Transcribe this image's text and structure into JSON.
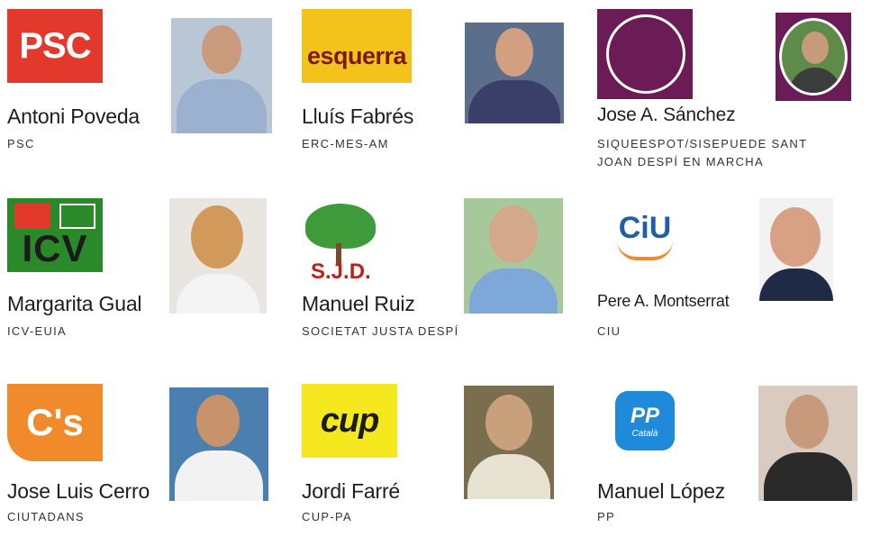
{
  "candidates": [
    {
      "name": "Antoni Poveda",
      "party": "PSC",
      "logo_text": "PSC",
      "logo": "psc-logo"
    },
    {
      "name": "Lluís Fabrés",
      "party": "ERC-MES-AM",
      "logo_text": "esquerra",
      "logo": "erc-logo"
    },
    {
      "name": "Jose A. Sánchez",
      "party": "SIQUEESPOT/SISEPUEDE SANT JOAN DESPÍ EN MARCHA",
      "logo_text": "",
      "logo": "sisepuede-logo"
    },
    {
      "name": "Margarita Gual",
      "party": "ICV-EUIA",
      "logo_text": "ICV",
      "logo": "icv-logo"
    },
    {
      "name": "Manuel Ruiz",
      "party": "SOCIETAT JUSTA DESPÍ",
      "logo_text": "S.J.D.",
      "logo": "sjd-logo"
    },
    {
      "name": "Pere A. Montserrat",
      "party": "CIU",
      "logo_text": "CiU",
      "logo": "ciu-logo"
    },
    {
      "name": "Jose Luis Cerro",
      "party": "CIUTADANS",
      "logo_text": "C's",
      "logo": "cs-logo"
    },
    {
      "name": "Jordi Farré",
      "party": "CUP-PA",
      "logo_text": "cup",
      "logo": "cup-logo"
    },
    {
      "name": "Manuel López",
      "party": "PP",
      "logo_text": "PP",
      "logo_subtext": "Català",
      "logo": "pp-logo"
    }
  ],
  "colors": {
    "psc": "#e3392d",
    "erc": "#f4c31b",
    "sisepuede": "#6b1c57",
    "icv": "#2a8a2a",
    "ciu": "#1f5ea8",
    "cs": "#f08a2a",
    "cup": "#f6e81e",
    "pp": "#1f8ad9"
  }
}
